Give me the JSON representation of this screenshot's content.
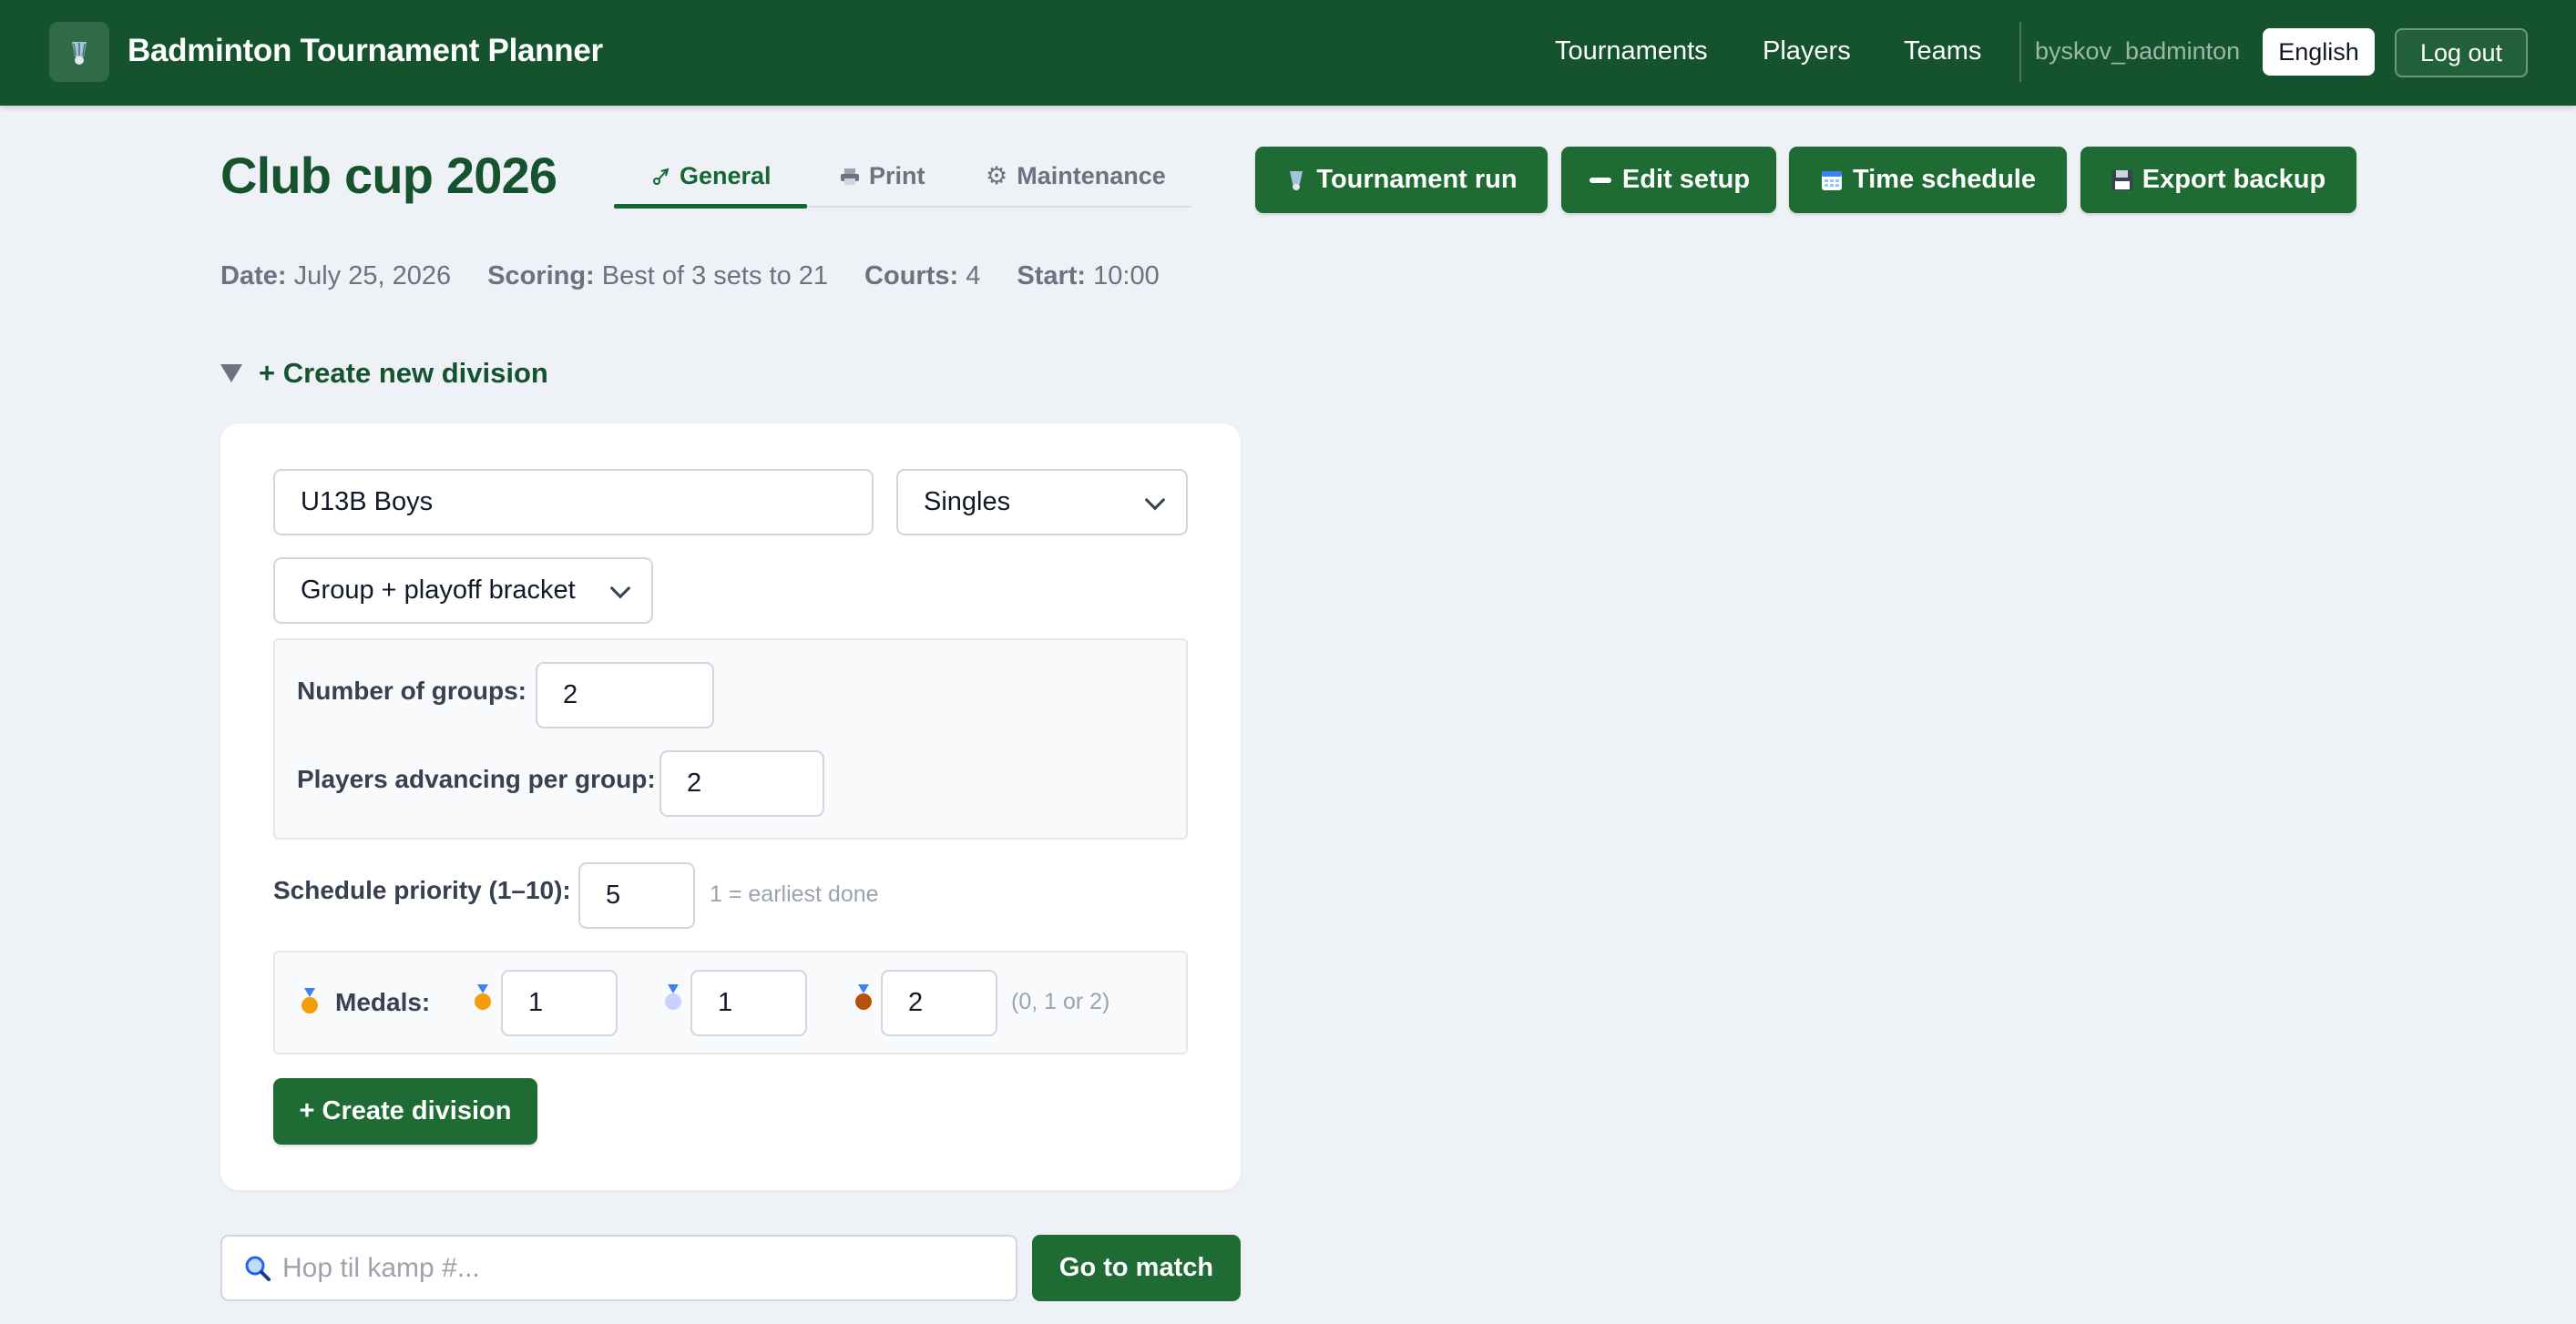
{
  "app": {
    "title": "Badminton Tournament Planner",
    "logo_icon": "shuttlecock-icon"
  },
  "nav": {
    "links": [
      "Tournaments",
      "Players",
      "Teams"
    ],
    "username": "byskov_badminton",
    "language": "English",
    "logout": "Log out"
  },
  "tournament": {
    "name": "Club cup 2026",
    "tabs": [
      {
        "label": "General",
        "icon": "shuttlecock-icon",
        "active": true
      },
      {
        "label": "Print",
        "icon": "printer-icon",
        "active": false
      },
      {
        "label": "Maintenance",
        "icon": "gear-icon",
        "active": false
      }
    ],
    "actions": [
      {
        "label": "Tournament run",
        "icon": "shuttlecock-icon"
      },
      {
        "label": "Edit setup",
        "icon": "pencil-icon"
      },
      {
        "label": "Time schedule",
        "icon": "calendar-icon"
      },
      {
        "label": "Export backup",
        "icon": "floppy-icon"
      }
    ],
    "meta": {
      "date_label": "Date:",
      "date": "July 25, 2026",
      "scoring_label": "Scoring:",
      "scoring": "Best of 3 sets to 21",
      "courts_label": "Courts:",
      "courts": "4",
      "start_label": "Start:",
      "start": "10:00"
    }
  },
  "division_form": {
    "summary": "+ Create new division",
    "name_value": "U13B Boys",
    "type_value": "Singles",
    "format_value": "Group + playoff bracket",
    "groups_label": "Number of groups:",
    "groups_value": "2",
    "advancing_label": "Players advancing per group:",
    "advancing_value": "2",
    "priority_label": "Schedule priority (1–10):",
    "priority_value": "5",
    "priority_hint": "1 = earliest done",
    "medals_label": "Medals:",
    "gold_value": "1",
    "silver_value": "1",
    "bronze_value": "2",
    "medals_hint": "(0, 1 or 2)",
    "submit": "+ Create division"
  },
  "search": {
    "placeholder": "Hop til kamp #...",
    "button": "Go to match"
  },
  "colors": {
    "brand": "#14532d",
    "button": "#1e6b34",
    "background": "#eef2f7"
  }
}
